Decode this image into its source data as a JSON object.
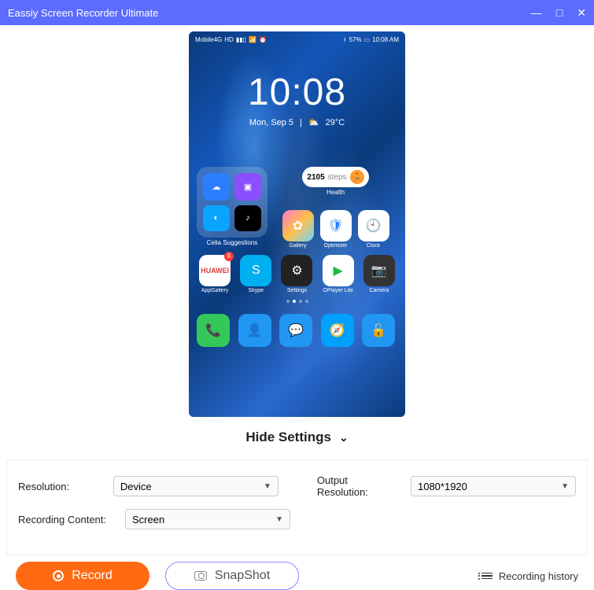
{
  "titlebar": {
    "title": "Eassiy Screen Recorder Ultimate"
  },
  "phone": {
    "status": {
      "carrier": "Mobile4G",
      "hd": "HD",
      "bt_batt": "57%",
      "time": "10:08 AM"
    },
    "clock": {
      "time": "10:08",
      "date": "Mon, Sep 5",
      "weather": "29°C"
    },
    "folder_label": "Celia Suggestions",
    "health": {
      "steps": "2105",
      "unit": "steps",
      "label": "Health"
    },
    "apps_row1": [
      {
        "label": "Gallery"
      },
      {
        "label": "Optimizer"
      },
      {
        "label": "Clock"
      }
    ],
    "apps_row2": [
      {
        "label": "AppGallery",
        "badge": "8"
      },
      {
        "label": "Skype"
      },
      {
        "label": "Settings"
      },
      {
        "label": "OPlayer Lite"
      },
      {
        "label": "Camera"
      }
    ]
  },
  "hide_settings": "Hide Settings",
  "settings": {
    "resolution_label": "Resolution:",
    "resolution_value": "Device",
    "output_label": "Output Resolution:",
    "output_value": "1080*1920",
    "content_label": "Recording Content:",
    "content_value": "Screen"
  },
  "buttons": {
    "record": "Record",
    "snapshot": "SnapShot",
    "history": "Recording history"
  }
}
